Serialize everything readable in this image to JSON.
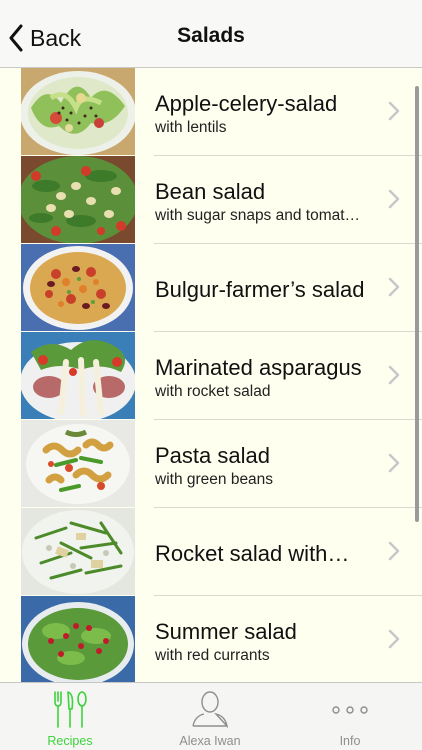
{
  "nav": {
    "back_label": "Back",
    "title": "Salads"
  },
  "recipes": [
    {
      "title": "Apple-celery-salad",
      "subtitle": "with lentils"
    },
    {
      "title": "Bean salad",
      "subtitle": "with sugar snaps and tomat…"
    },
    {
      "title": "Bulgur-farmer’s salad",
      "subtitle": ""
    },
    {
      "title": "Marinated asparagus",
      "subtitle": "with rocket salad"
    },
    {
      "title": "Pasta salad",
      "subtitle": "with green beans"
    },
    {
      "title": "Rocket salad with…",
      "subtitle": ""
    },
    {
      "title": "Summer salad",
      "subtitle": "with red currants"
    }
  ],
  "tabs": [
    {
      "label": "Recipes",
      "icon": "fork-knife-spoon-icon",
      "selected": true
    },
    {
      "label": "Alexa Iwan",
      "icon": "person-icon",
      "selected": false
    },
    {
      "label": "Info",
      "icon": "more-dots-icon",
      "selected": false
    }
  ],
  "colors": {
    "background": "#fffff0",
    "tab_selected": "#3cd33c",
    "tab_unselected": "#8e8e8e",
    "chevron": "#c7c7cc"
  }
}
